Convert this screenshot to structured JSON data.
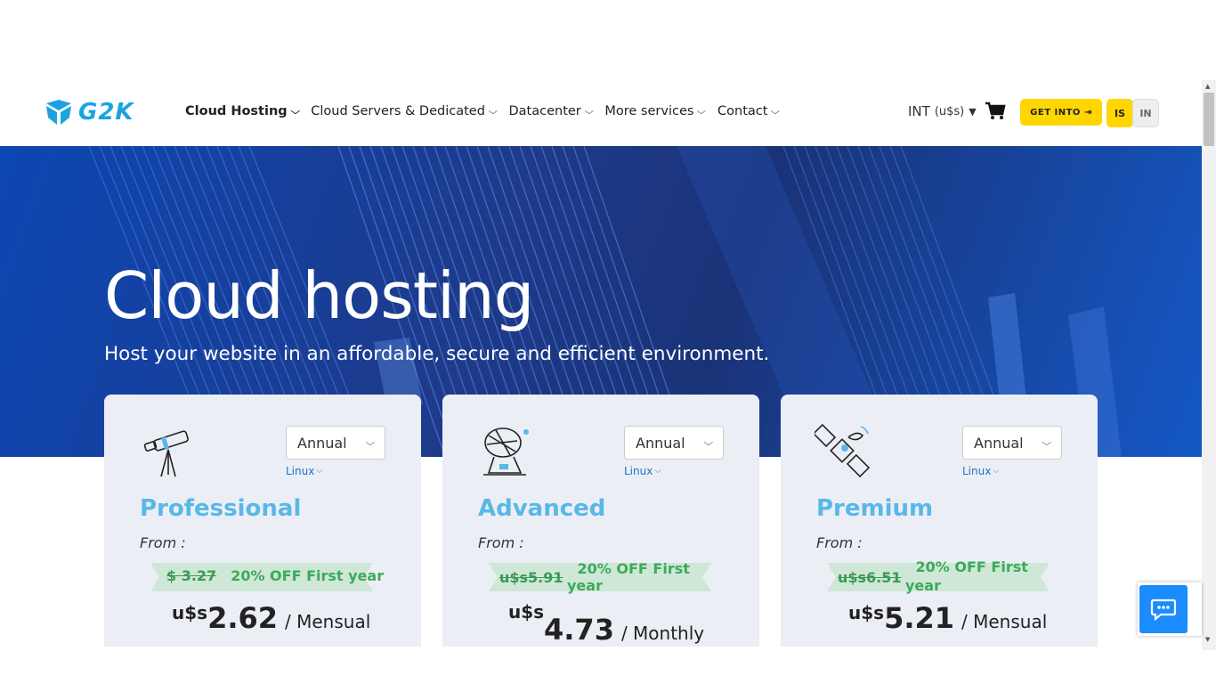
{
  "header": {
    "logo_text": "G2K",
    "nav": [
      {
        "label": "Cloud Hosting",
        "active": true
      },
      {
        "label": "Cloud Servers & Dedicated",
        "active": false
      },
      {
        "label": "Datacenter",
        "active": false
      },
      {
        "label": "More services",
        "active": false
      },
      {
        "label": "Contact",
        "active": false
      }
    ],
    "currency": "INT",
    "currency_unit": "(u$s)",
    "get_into_label": "GET INTO",
    "lang_is": "IS",
    "lang_in": "IN"
  },
  "hero": {
    "title": "Cloud hosting",
    "subtitle": "Host your website in an affordable, secure and efficient environment."
  },
  "plans": [
    {
      "icon": "telescope-icon",
      "billing": "Annual",
      "os": "Linux",
      "name": "Professional",
      "from": "From :",
      "old_price": "$ 3.27",
      "discount": "20% OFF First year",
      "currency": "u$s",
      "price": "2.62",
      "period": "/ Mensual"
    },
    {
      "icon": "satellite-dish-icon",
      "billing": "Annual",
      "os": "Linux",
      "name": "Advanced",
      "from": "From :",
      "old_price": "u$s5.91",
      "discount_line1": "20% OFF First",
      "discount_line2": "year",
      "currency": "u$s",
      "price": "4.73",
      "period": "/ Monthly"
    },
    {
      "icon": "satellite-icon",
      "billing": "Annual",
      "os": "Linux",
      "name": "Premium",
      "from": "From :",
      "old_price": "u$s6.51",
      "discount_line1": "20% OFF First",
      "discount_line2": "year",
      "currency": "u$s",
      "price": "5.21",
      "period": "/ Mensual"
    }
  ],
  "colors": {
    "accent_yellow": "#ffd600",
    "plan_name": "#58b8e8",
    "discount_green": "#3bab5a",
    "hero_blue": "#1e3a8a",
    "chat_blue": "#1a8cff"
  }
}
